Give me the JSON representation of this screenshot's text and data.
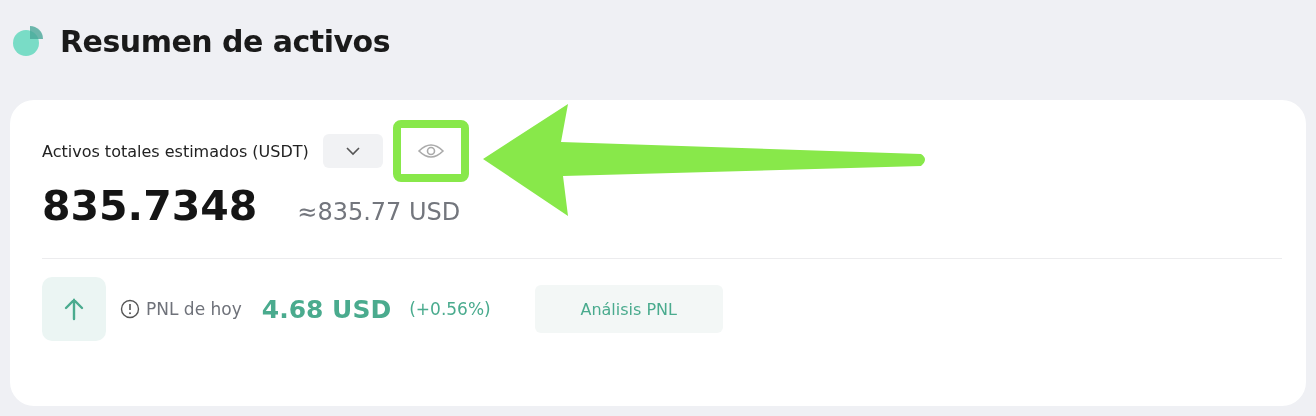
{
  "title": "Resumen de activos",
  "balance": {
    "label": "Activos totales estimados (USDT)",
    "amount": "835.7348",
    "approx": "≈835.77 USD"
  },
  "pnl": {
    "rising": true,
    "label": "PNL de hoy",
    "value": "4.68 USD",
    "percent": "(+0.56%)",
    "button": "Análisis PNL"
  }
}
